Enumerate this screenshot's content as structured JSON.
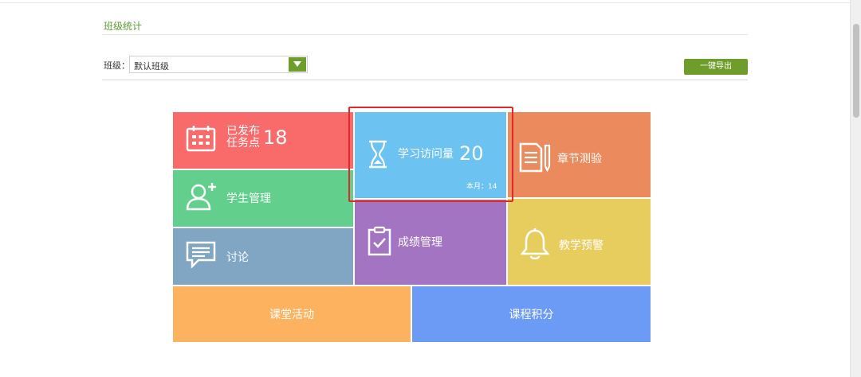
{
  "header": {
    "section_title": "班级统计",
    "class_label": "班级：",
    "class_select_value": "默认班级",
    "export_label": "一键导出"
  },
  "tiles": {
    "task": {
      "line1": "已发布",
      "line2": "任务点",
      "count": "18"
    },
    "visit": {
      "label": "学习访问量",
      "count": "20",
      "month": "本月：14"
    },
    "chapter": {
      "label": "章节测验"
    },
    "student": {
      "label": "学生管理"
    },
    "discuss": {
      "label": "讨论"
    },
    "grade": {
      "label": "成绩管理"
    },
    "warning": {
      "label": "教学预警"
    },
    "classroom": {
      "label": "课堂活动"
    },
    "points": {
      "label": "课程积分"
    }
  },
  "colors": {
    "accent_green": "#6e9d2b",
    "task": "#f96b6b",
    "visit": "#6cc2f1",
    "chapter": "#ea8a5d",
    "student": "#62cf8d",
    "discuss": "#80a6c3",
    "grade": "#a374c2",
    "warning": "#e7cd5e",
    "classroom": "#fdb25f",
    "points": "#6c9bf6",
    "highlight": "#e02a2a"
  },
  "icons": {
    "task": "calendar-icon",
    "visit": "hourglass-icon",
    "chapter": "document-pen-icon",
    "student": "add-user-icon",
    "discuss": "chat-icon",
    "grade": "clipboard-check-icon",
    "warning": "bell-icon"
  }
}
